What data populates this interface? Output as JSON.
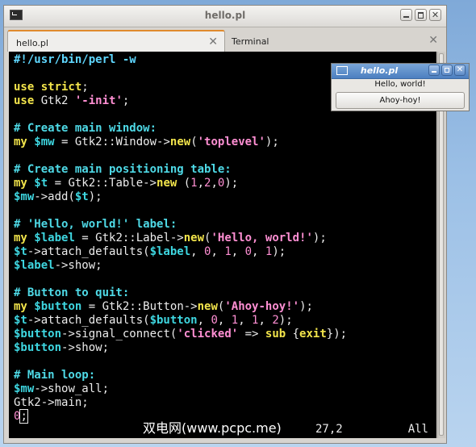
{
  "terminal_window": {
    "title": "hello.pl",
    "tabs": [
      {
        "label": "hello.pl",
        "close": "✕"
      },
      {
        "label": "Terminal",
        "close": "✕"
      }
    ],
    "window_buttons": {
      "minimize": "",
      "maximize": "",
      "close": "✕"
    }
  },
  "code_lines": [
    [
      {
        "t": "#!/usr/bin/perl -w",
        "c": "shebang"
      }
    ],
    [],
    [
      {
        "t": "use strict",
        "c": "kw"
      },
      {
        "t": ";",
        "c": ""
      }
    ],
    [
      {
        "t": "use",
        "c": "kw"
      },
      {
        "t": " Gtk2 ",
        "c": ""
      },
      {
        "t": "'-init'",
        "c": "str"
      },
      {
        "t": ";",
        "c": ""
      }
    ],
    [],
    [
      {
        "t": "# Create main window:",
        "c": "comment"
      }
    ],
    [
      {
        "t": "my",
        "c": "kw"
      },
      {
        "t": " ",
        "c": ""
      },
      {
        "t": "$mw",
        "c": "var"
      },
      {
        "t": " = Gtk2::Window->",
        "c": ""
      },
      {
        "t": "new",
        "c": "kw"
      },
      {
        "t": "(",
        "c": ""
      },
      {
        "t": "'toplevel'",
        "c": "str"
      },
      {
        "t": ");",
        "c": ""
      }
    ],
    [],
    [
      {
        "t": "# Create main positioning table:",
        "c": "comment"
      }
    ],
    [
      {
        "t": "my",
        "c": "kw"
      },
      {
        "t": " ",
        "c": ""
      },
      {
        "t": "$t",
        "c": "var"
      },
      {
        "t": " = Gtk2::Table->",
        "c": ""
      },
      {
        "t": "new",
        "c": "kw"
      },
      {
        "t": " (",
        "c": ""
      },
      {
        "t": "1",
        "c": "num"
      },
      {
        "t": ",",
        "c": ""
      },
      {
        "t": "2",
        "c": "num"
      },
      {
        "t": ",",
        "c": ""
      },
      {
        "t": "0",
        "c": "num"
      },
      {
        "t": ");",
        "c": ""
      }
    ],
    [
      {
        "t": "$mw",
        "c": "var"
      },
      {
        "t": "->add(",
        "c": ""
      },
      {
        "t": "$t",
        "c": "var"
      },
      {
        "t": ");",
        "c": ""
      }
    ],
    [],
    [
      {
        "t": "# 'Hello, world!' label:",
        "c": "comment"
      }
    ],
    [
      {
        "t": "my",
        "c": "kw"
      },
      {
        "t": " ",
        "c": ""
      },
      {
        "t": "$label",
        "c": "var"
      },
      {
        "t": " = Gtk2::Label->",
        "c": ""
      },
      {
        "t": "new",
        "c": "kw"
      },
      {
        "t": "(",
        "c": ""
      },
      {
        "t": "'Hello, world!'",
        "c": "str"
      },
      {
        "t": ");",
        "c": ""
      }
    ],
    [
      {
        "t": "$t",
        "c": "var"
      },
      {
        "t": "->attach_defaults(",
        "c": ""
      },
      {
        "t": "$label",
        "c": "var"
      },
      {
        "t": ", ",
        "c": ""
      },
      {
        "t": "0",
        "c": "num"
      },
      {
        "t": ", ",
        "c": ""
      },
      {
        "t": "1",
        "c": "num"
      },
      {
        "t": ", ",
        "c": ""
      },
      {
        "t": "0",
        "c": "num"
      },
      {
        "t": ", ",
        "c": ""
      },
      {
        "t": "1",
        "c": "num"
      },
      {
        "t": ");",
        "c": ""
      }
    ],
    [
      {
        "t": "$label",
        "c": "var"
      },
      {
        "t": "->show;",
        "c": ""
      }
    ],
    [],
    [
      {
        "t": "# Button to quit:",
        "c": "comment"
      }
    ],
    [
      {
        "t": "my",
        "c": "kw"
      },
      {
        "t": " ",
        "c": ""
      },
      {
        "t": "$button",
        "c": "var"
      },
      {
        "t": " = Gtk2::Button->",
        "c": ""
      },
      {
        "t": "new",
        "c": "kw"
      },
      {
        "t": "(",
        "c": ""
      },
      {
        "t": "'Ahoy-hoy!'",
        "c": "str"
      },
      {
        "t": ");",
        "c": ""
      }
    ],
    [
      {
        "t": "$t",
        "c": "var"
      },
      {
        "t": "->attach_defaults(",
        "c": ""
      },
      {
        "t": "$button",
        "c": "var"
      },
      {
        "t": ", ",
        "c": ""
      },
      {
        "t": "0",
        "c": "num"
      },
      {
        "t": ", ",
        "c": ""
      },
      {
        "t": "1",
        "c": "num"
      },
      {
        "t": ", ",
        "c": ""
      },
      {
        "t": "1",
        "c": "num"
      },
      {
        "t": ", ",
        "c": ""
      },
      {
        "t": "2",
        "c": "num"
      },
      {
        "t": ");",
        "c": ""
      }
    ],
    [
      {
        "t": "$button",
        "c": "var"
      },
      {
        "t": "->signal_connect(",
        "c": ""
      },
      {
        "t": "'clicked'",
        "c": "str"
      },
      {
        "t": " => ",
        "c": ""
      },
      {
        "t": "sub",
        "c": "kw"
      },
      {
        "t": " {",
        "c": ""
      },
      {
        "t": "exit",
        "c": "kw"
      },
      {
        "t": "});",
        "c": ""
      }
    ],
    [
      {
        "t": "$button",
        "c": "var"
      },
      {
        "t": "->show;",
        "c": ""
      }
    ],
    [],
    [
      {
        "t": "# Main loop:",
        "c": "comment"
      }
    ],
    [
      {
        "t": "$mw",
        "c": "var"
      },
      {
        "t": "->show_all;",
        "c": ""
      }
    ],
    [
      {
        "t": "Gtk2->main;",
        "c": ""
      }
    ],
    [
      {
        "t": "0",
        "c": "num"
      },
      {
        "t": ";",
        "c": "cursor"
      }
    ]
  ],
  "status_bar": {
    "position": "27,2",
    "scroll": "All"
  },
  "watermark": "双电网(www.pcpc.me)",
  "app_window": {
    "title": "hello.pl",
    "label": "Hello, world!",
    "button": "Ahoy-hoy!",
    "close": "✕"
  },
  "colors": {
    "keyword": "#f2e44b",
    "variable": "#3ed6e0",
    "string": "#ff8fd3",
    "comment": "#4ed9e6",
    "tab_accent": "#e08a2d",
    "app_titlebar": "#4c7fc0"
  },
  "icons": [
    "terminal-icon",
    "minimize-icon",
    "maximize-icon",
    "close-icon",
    "window-icon"
  ]
}
